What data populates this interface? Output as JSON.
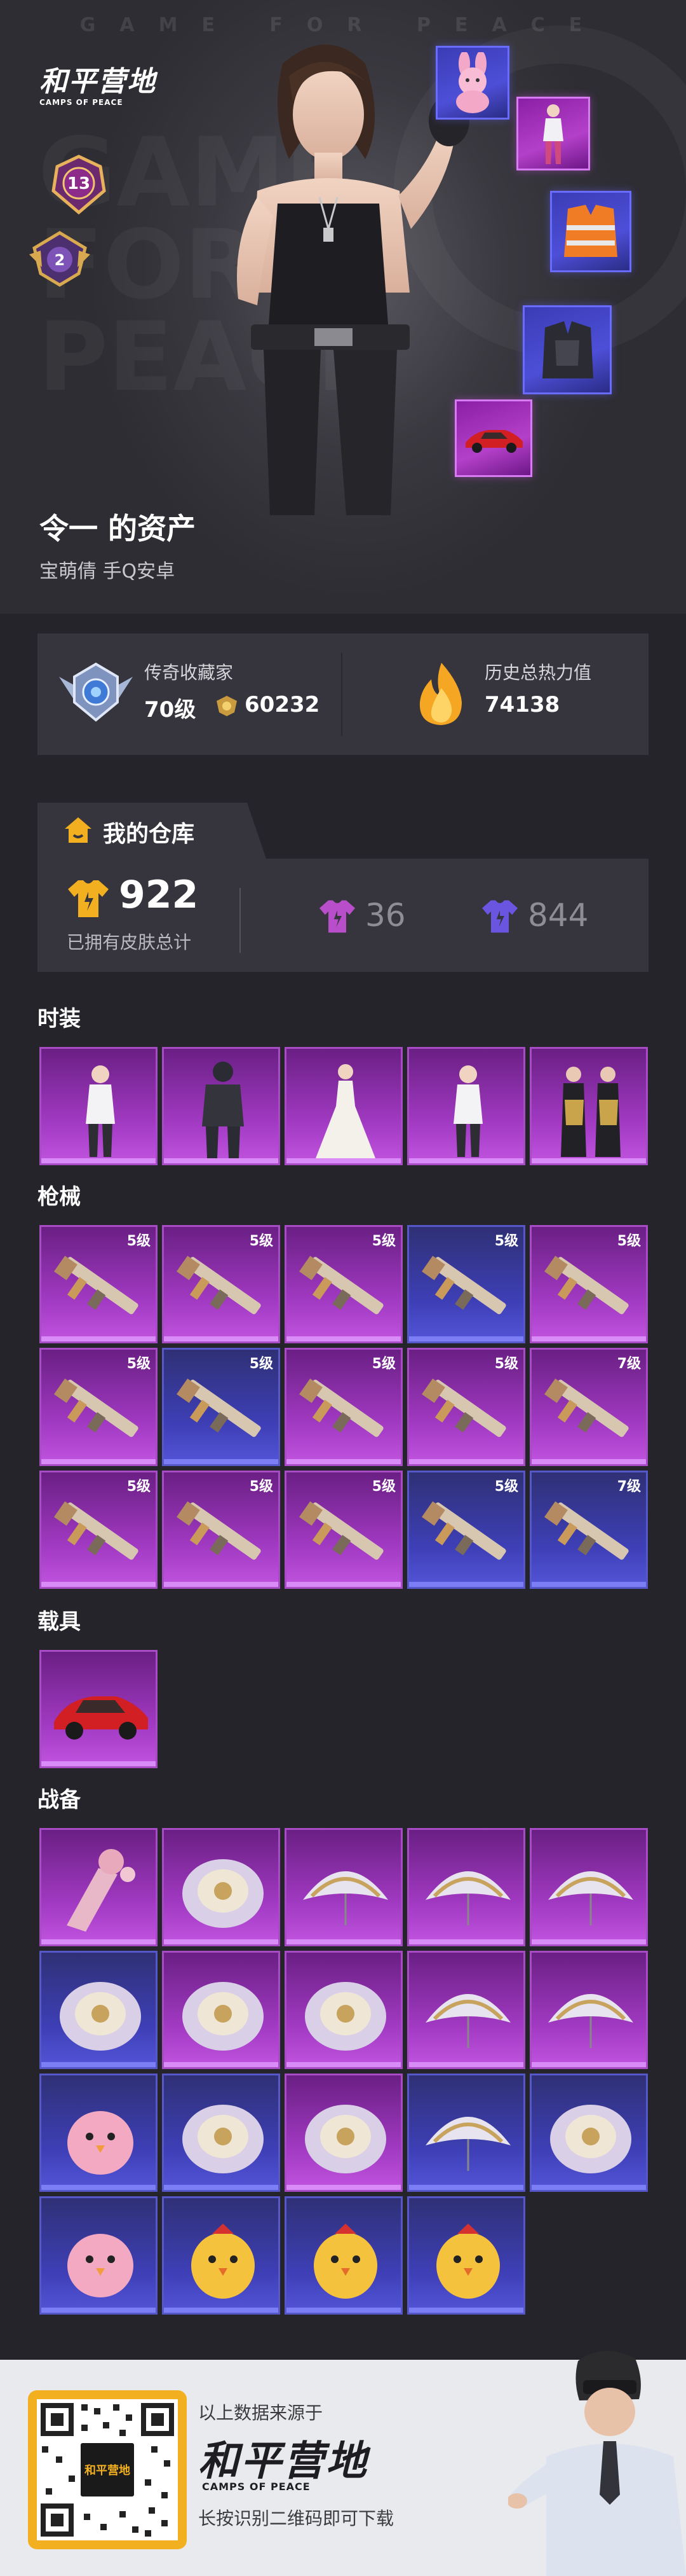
{
  "hero": {
    "top_watermark": "GAME FOR PEACE",
    "bg_watermark": "GAME FOR PEACE",
    "logo_cn": "和平营地",
    "logo_en": "CAMPS OF PEACE",
    "rank_level": "13",
    "tier_level": "2",
    "owner_title": "令一 的资产",
    "owner_sub": "宝萌倩  手Q安卓"
  },
  "stats": {
    "collector_label": "传奇收藏家",
    "collector_level": "70级",
    "collector_points": "60232",
    "heat_label": "历史总热力值",
    "heat_value": "74138"
  },
  "warehouse": {
    "title": "我的仓库",
    "total_skins": "922",
    "total_label": "已拥有皮肤总计",
    "purple_count": "36",
    "blue_count": "844"
  },
  "sections": {
    "outfits": "时装",
    "weapons": "枪械",
    "vehicles": "载具",
    "gear": "战备"
  },
  "weapon_levels": [
    "5级",
    "5级",
    "5级",
    "5级",
    "5级",
    "5级",
    "5级",
    "5级",
    "5级",
    "7级",
    "5级",
    "5级",
    "5级",
    "5级",
    "7级"
  ],
  "footer": {
    "source": "以上数据来源于",
    "logo_cn": "和平营地",
    "logo_en": "CAMPS OF PEACE",
    "hint": "长按识别二维码即可下载",
    "qr_logo": "和平营地"
  },
  "colors": {
    "purple_tile": "#a23ac3",
    "blue_tile": "#3e3fb6",
    "background": "#25242b",
    "panel": "#36353d",
    "gold": "#f2b020"
  }
}
